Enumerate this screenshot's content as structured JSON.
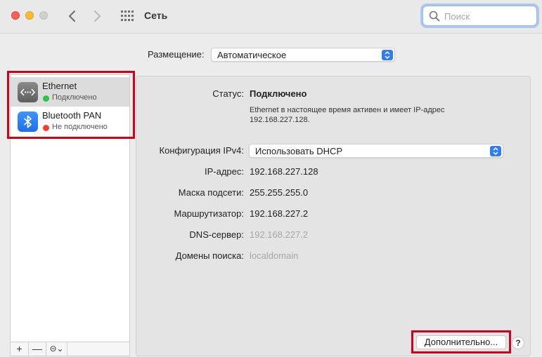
{
  "window": {
    "title": "Сеть"
  },
  "search": {
    "placeholder": "Поиск",
    "value": ""
  },
  "location": {
    "label": "Размещение:",
    "value": "Автоматическое"
  },
  "sidebar": {
    "items": [
      {
        "name": "Ethernet",
        "status": "Подключено",
        "status_color": "#28c840",
        "icon": "ethernet-icon",
        "selected": true
      },
      {
        "name": "Bluetooth PAN",
        "status": "Не подключено",
        "status_color": "#ff3b30",
        "icon": "bluetooth-icon",
        "selected": false
      }
    ],
    "buttons": {
      "add": "+",
      "remove": "—",
      "more": "⊝⌄"
    }
  },
  "detail": {
    "status_label": "Статус:",
    "status_value": "Подключено",
    "status_description": "Ethernet в настоящее время активен и имеет IP-адрес 192.168.227.128.",
    "config_label": "Конфигурация IPv4:",
    "config_value": "Использовать DHCP",
    "ip_label": "IP-адрес:",
    "ip_value": "192.168.227.128",
    "mask_label": "Маска подсети:",
    "mask_value": "255.255.255.0",
    "router_label": "Маршрутизатор:",
    "router_value": "192.168.227.2",
    "dns_label": "DNS-сервер:",
    "dns_value": "192.168.227.2",
    "domains_label": "Домены поиска:",
    "domains_value": "localdomain"
  },
  "footer": {
    "advanced_label": "Дополнительно...",
    "help_label": "?"
  },
  "colors": {
    "accent": "#2e7cf6",
    "highlight": "#d0021b"
  }
}
